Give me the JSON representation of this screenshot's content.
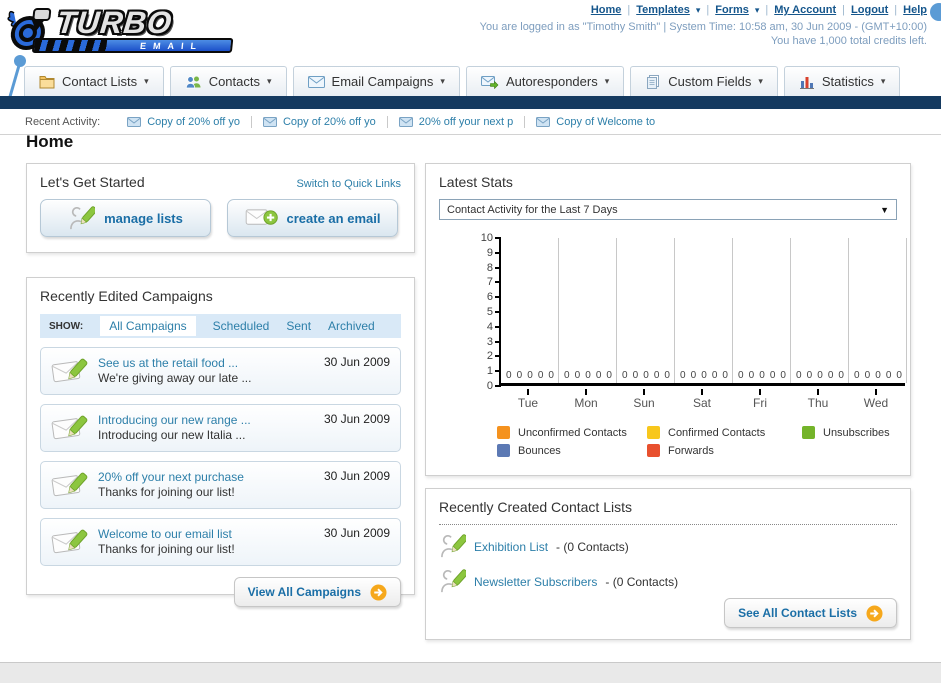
{
  "header": {
    "logo_line1": "TURBO",
    "logo_line2": "EMAIL",
    "nav_links": [
      {
        "label": "Home",
        "dropdown": false
      },
      {
        "label": "Templates",
        "dropdown": true
      },
      {
        "label": "Forms",
        "dropdown": true
      },
      {
        "label": "My Account",
        "dropdown": false
      },
      {
        "label": "Logout",
        "dropdown": false
      },
      {
        "label": "Help",
        "dropdown": false
      }
    ],
    "login_info": "You are logged in as \"Timothy Smith\" | System Time: 10:58 am, 30 Jun 2009 - (GMT+10:00)",
    "credits_info": "You have 1,000 total credits left."
  },
  "tabs": [
    {
      "label": "Contact Lists",
      "icon": "contact-lists-folder-icon"
    },
    {
      "label": "Contacts",
      "icon": "contacts-people-icon"
    },
    {
      "label": "Email Campaigns",
      "icon": "email-campaigns-envelope-icon"
    },
    {
      "label": "Autoresponders",
      "icon": "autoresponders-envelope-arrow-icon"
    },
    {
      "label": "Custom Fields",
      "icon": "custom-fields-pages-icon"
    },
    {
      "label": "Statistics",
      "icon": "statistics-chart-icon"
    }
  ],
  "recent_activity": {
    "label": "Recent Activity:",
    "items": [
      "Copy of 20% off yo",
      "Copy of 20% off yo",
      "20% off your next p",
      "Copy of Welcome to"
    ]
  },
  "page_title": "Home",
  "get_started": {
    "title": "Let's Get Started",
    "switch_link": "Switch to Quick Links",
    "buttons": [
      {
        "label": "manage lists",
        "icon": "person-pencil-icon"
      },
      {
        "label": "create an email",
        "icon": "envelope-plus-icon"
      }
    ]
  },
  "campaigns": {
    "title": "Recently Edited Campaigns",
    "show_label": "SHOW:",
    "filters": [
      "All Campaigns",
      "Scheduled",
      "Sent",
      "Archived"
    ],
    "active_filter": "All Campaigns",
    "items": [
      {
        "title": "See us at the retail food ...",
        "subtitle": "We're giving away our late ...",
        "date": "30 Jun 2009"
      },
      {
        "title": "Introducing our new range ...",
        "subtitle": "Introducing our new Italia ...",
        "date": "30 Jun 2009"
      },
      {
        "title": "20% off your next purchase",
        "subtitle": "Thanks for joining our list!",
        "date": "30 Jun 2009"
      },
      {
        "title": "Welcome to our email list",
        "subtitle": "Thanks for joining our list!",
        "date": "30 Jun 2009"
      }
    ],
    "view_all_label": "View All Campaigns"
  },
  "stats": {
    "title": "Latest Stats",
    "dropdown_value": "Contact Activity for the Last 7 Days"
  },
  "chart_data": {
    "type": "bar",
    "title": "Contact Activity for the Last 7 Days",
    "categories": [
      "Tue",
      "Mon",
      "Sun",
      "Sat",
      "Fri",
      "Thu",
      "Wed"
    ],
    "series": [
      {
        "name": "Unconfirmed Contacts",
        "color": "#f5921e",
        "values": [
          0,
          0,
          0,
          0,
          0,
          0,
          0
        ]
      },
      {
        "name": "Confirmed Contacts",
        "color": "#f8c71c",
        "values": [
          0,
          0,
          0,
          0,
          0,
          0,
          0
        ]
      },
      {
        "name": "Unsubscribes",
        "color": "#74b42a",
        "values": [
          0,
          0,
          0,
          0,
          0,
          0,
          0
        ]
      },
      {
        "name": "Bounces",
        "color": "#5c79b4",
        "values": [
          0,
          0,
          0,
          0,
          0,
          0,
          0
        ]
      },
      {
        "name": "Forwards",
        "color": "#e8502e",
        "values": [
          0,
          0,
          0,
          0,
          0,
          0,
          0
        ]
      }
    ],
    "ylim": [
      0,
      10
    ],
    "ytick_step": 1,
    "grid": true,
    "legend_position": "bottom"
  },
  "contact_lists": {
    "title": "Recently Created Contact Lists",
    "items": [
      {
        "name": "Exhibition List",
        "detail": "- (0 Contacts)",
        "icon": "person-pencil-icon"
      },
      {
        "name": "Newsletter Subscribers",
        "detail": "- (0 Contacts)",
        "icon": "person-pencil-icon"
      }
    ],
    "see_all_label": "See All Contact Lists"
  },
  "colors": {
    "link": "#2d7fa9",
    "nav_bar": "#153a60",
    "button_text": "#1a6ea6",
    "arrow_button": "#f6a81c"
  }
}
